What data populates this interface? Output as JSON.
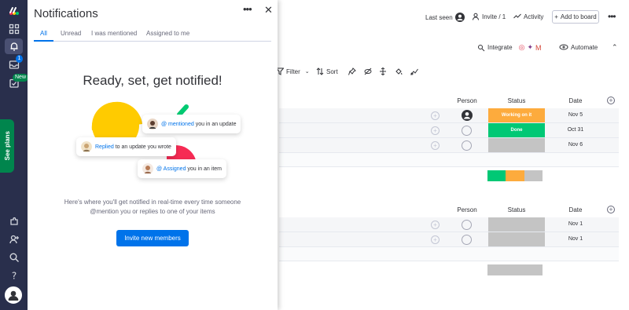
{
  "panel": {
    "title": "Notifications",
    "tabs": [
      {
        "label": "All"
      },
      {
        "label": "Unread"
      },
      {
        "label": "I was mentioned"
      },
      {
        "label": "Assigned to me"
      }
    ],
    "empty_title": "Ready, set, get notified!",
    "bubbles": {
      "mentioned": {
        "link": "@ mentioned",
        "text": " you in an update"
      },
      "replied": {
        "link": "Replied",
        "text": " to an update you wrote"
      },
      "assigned": {
        "link": "@ Assigned",
        "text": " you in an item"
      }
    },
    "description": "Here's where you'll get notified in real-time every time someone @mention you or replies to one of your items",
    "invite_button": "Invite new members"
  },
  "rail": {
    "inbox_badge": "1",
    "new_badge": "New",
    "see_plans": "See plans"
  },
  "board": {
    "last_seen": "Last seen",
    "invite": "Invite / 1",
    "activity": "Activity",
    "add_to_board": "Add to board",
    "integrate": "Integrate",
    "automate": "Automate",
    "filter": "Filter",
    "sort": "Sort",
    "groups": [
      {
        "headers": {
          "person": "Person",
          "status": "Status",
          "date": "Date"
        },
        "rows": [
          {
            "status": "Working on it",
            "status_color": "#fdab3d",
            "date": "Nov 5",
            "person": "filled"
          },
          {
            "status": "Done",
            "status_color": "#00c875",
            "date": "Oct 31",
            "person": "empty"
          },
          {
            "status": "",
            "status_color": "#c4c4c4",
            "date": "Nov 6",
            "person": "empty"
          }
        ],
        "summary": [
          {
            "color": "#00c875",
            "share": 0.33
          },
          {
            "color": "#fdab3d",
            "share": 0.33
          },
          {
            "color": "#c4c4c4",
            "share": 0.34
          }
        ]
      },
      {
        "headers": {
          "person": "Person",
          "status": "Status",
          "date": "Date"
        },
        "rows": [
          {
            "status": "",
            "status_color": "#c4c4c4",
            "date": "Nov 1",
            "person": "empty"
          },
          {
            "status": "",
            "status_color": "#c4c4c4",
            "date": "Nov 1",
            "person": "empty"
          }
        ],
        "summary": [
          {
            "color": "#c4c4c4",
            "share": 1.0
          }
        ]
      }
    ]
  },
  "colors": {
    "rail": "#292f4c",
    "primary": "#0073ea",
    "done": "#00c875",
    "working": "#fdab3d",
    "empty_status": "#c4c4c4",
    "see_plans": "#00854d"
  }
}
